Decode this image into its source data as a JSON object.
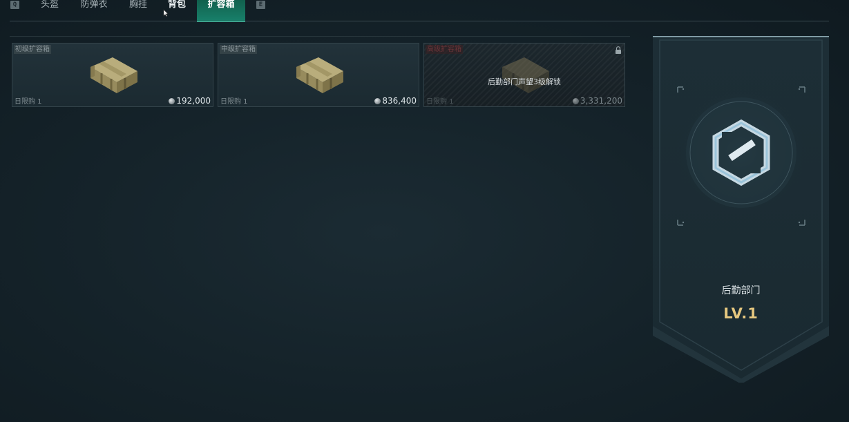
{
  "tabs": {
    "prev_key": "Q",
    "next_key": "E",
    "items": [
      {
        "label": "头盔"
      },
      {
        "label": "防弹衣"
      },
      {
        "label": "胸挂"
      },
      {
        "label": "背包"
      },
      {
        "label": "扩容箱"
      }
    ],
    "active_index": 4
  },
  "items": [
    {
      "name": "初级扩容箱",
      "limit": "日限购 1",
      "price": "192,000",
      "locked": false
    },
    {
      "name": "中级扩容箱",
      "limit": "日限购 1",
      "price": "836,400",
      "locked": false
    },
    {
      "name": "高级扩容箱",
      "limit": "日限购 1",
      "price": "3,331,200",
      "locked": true,
      "lock_message": "后勤部门声望3级解锁"
    }
  ],
  "department": {
    "name": "后勤部门",
    "level": "LV.1"
  },
  "colors": {
    "active_tab": "#18806a",
    "level_gold": "#e5c77f",
    "locked_name": "#6a3438"
  },
  "icons": [
    "coin-icon",
    "lock-icon",
    "department-emblem-icon",
    "crate-icon"
  ]
}
